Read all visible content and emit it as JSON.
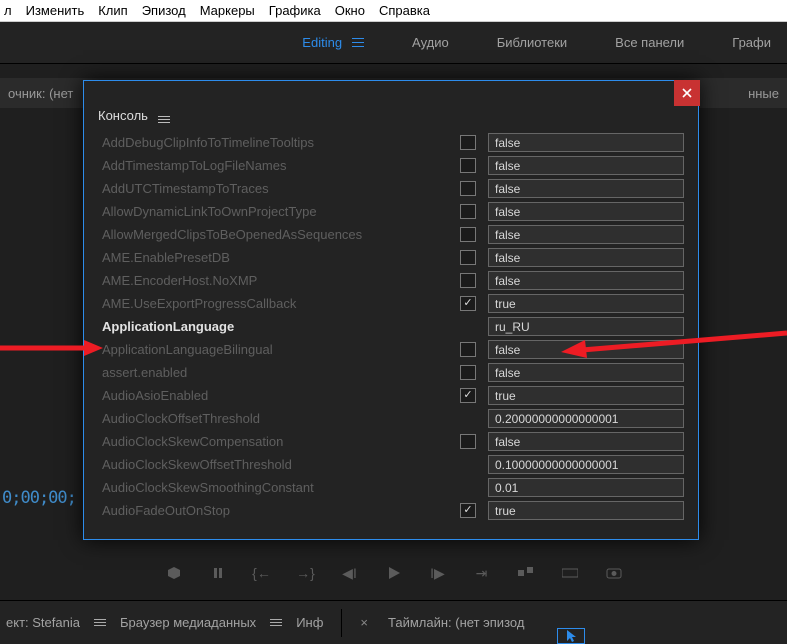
{
  "app_menu": {
    "edit": "Изменить",
    "clip": "Клип",
    "episode": "Эпизод",
    "markers": "Маркеры",
    "graphics": "Графика",
    "window": "Окно",
    "help": "Справка"
  },
  "workspaces": {
    "editing": "Editing",
    "audio": "Аудио",
    "libraries": "Библиотеки",
    "all_panels": "Все панели",
    "graphics": "Графи"
  },
  "panel_left_label": "очник: (нет",
  "panel_right_label": "нные",
  "timecode": "0;00;00;",
  "console": {
    "title": "Консоль",
    "rows": [
      {
        "key": "AddDebugClipInfoToTimelineTooltips",
        "cb": true,
        "checked": false,
        "val": "false"
      },
      {
        "key": "AddTimestampToLogFileNames",
        "cb": true,
        "checked": false,
        "val": "false"
      },
      {
        "key": "AddUTCTimestampToTraces",
        "cb": true,
        "checked": false,
        "val": "false"
      },
      {
        "key": "AllowDynamicLinkToOwnProjectType",
        "cb": true,
        "checked": false,
        "val": "false"
      },
      {
        "key": "AllowMergedClipsToBeOpenedAsSequences",
        "cb": true,
        "checked": false,
        "val": "false"
      },
      {
        "key": "AME.EnablePresetDB",
        "cb": true,
        "checked": false,
        "val": "false"
      },
      {
        "key": "AME.EncoderHost.NoXMP",
        "cb": true,
        "checked": false,
        "val": "false"
      },
      {
        "key": "AME.UseExportProgressCallback",
        "cb": true,
        "checked": true,
        "val": "true"
      },
      {
        "key": "ApplicationLanguage",
        "cb": false,
        "checked": false,
        "val": "ru_RU",
        "highlight": true
      },
      {
        "key": "ApplicationLanguageBilingual",
        "cb": true,
        "checked": false,
        "val": "false"
      },
      {
        "key": "assert.enabled",
        "cb": true,
        "checked": false,
        "val": "false"
      },
      {
        "key": "AudioAsioEnabled",
        "cb": true,
        "checked": true,
        "val": "true"
      },
      {
        "key": "AudioClockOffsetThreshold",
        "cb": false,
        "checked": false,
        "val": "0.20000000000000001"
      },
      {
        "key": "AudioClockSkewCompensation",
        "cb": true,
        "checked": false,
        "val": "false"
      },
      {
        "key": "AudioClockSkewOffsetThreshold",
        "cb": false,
        "checked": false,
        "val": "0.10000000000000001"
      },
      {
        "key": "AudioClockSkewSmoothingConstant",
        "cb": false,
        "checked": false,
        "val": "0.01"
      },
      {
        "key": "AudioFadeOutOnStop",
        "cb": true,
        "checked": true,
        "val": "true"
      }
    ]
  },
  "bottom": {
    "project_prefix": "ект:",
    "project_name": "Stefania",
    "media_browser": "Браузер медиаданных",
    "info": "Инф",
    "timeline_label": "Таймлайн: (нет эпизод"
  }
}
